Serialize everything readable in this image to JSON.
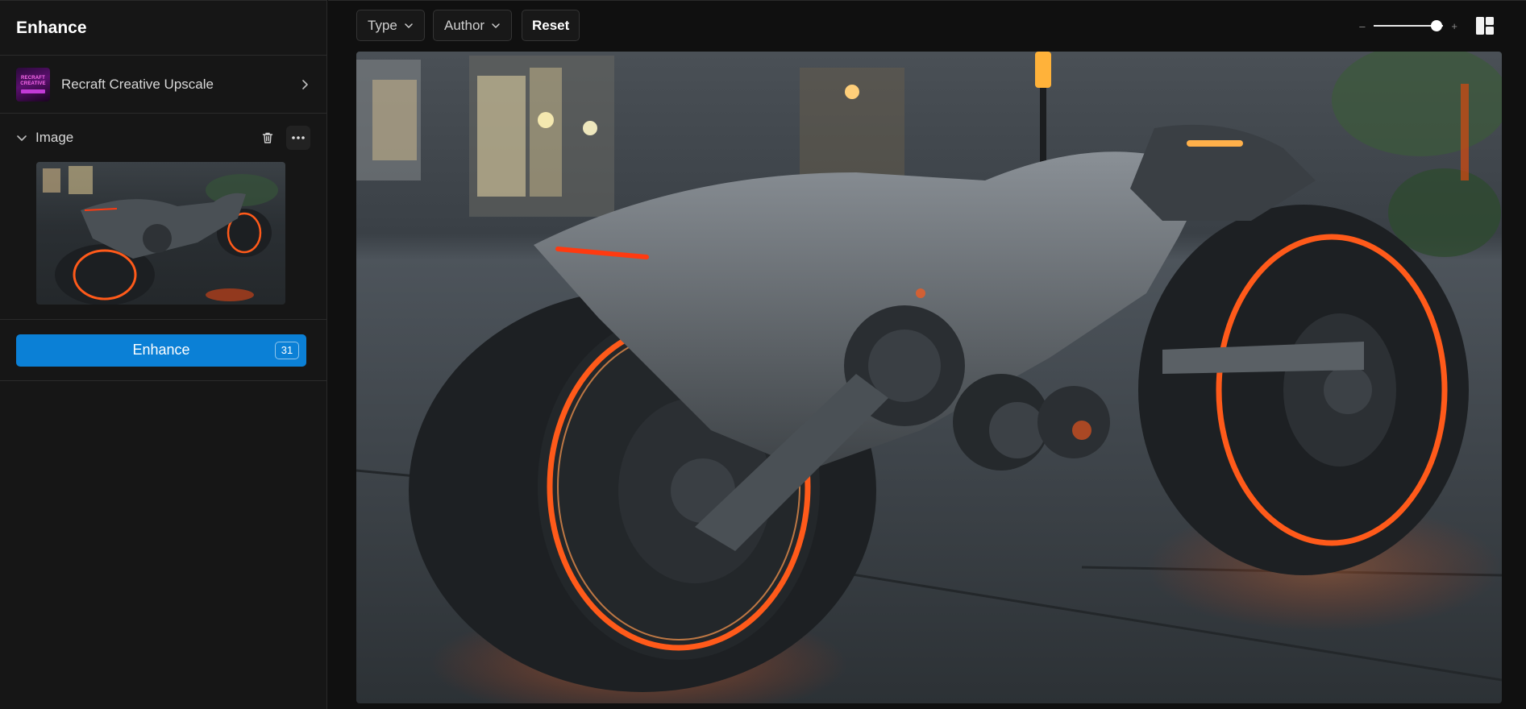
{
  "sidebar": {
    "title": "Enhance",
    "model": {
      "label": "Recraft Creative Upscale",
      "thumb_lines": [
        "RECRAFT",
        "CREATIVE"
      ]
    },
    "image_section": {
      "label": "Image"
    },
    "enhance_button": {
      "label": "Enhance",
      "credits": "31"
    }
  },
  "toolbar": {
    "type_filter": "Type",
    "author_filter": "Author",
    "reset_label": "Reset",
    "zoom": {
      "minus": "–",
      "plus": "+",
      "level_fraction": 0.9
    }
  },
  "colors": {
    "accent": "#0b80d6",
    "background": "#101010",
    "sidebar": "#161616",
    "glow": "#ff5a1a"
  },
  "icons": [
    "chevron-right-icon",
    "chevron-down-icon",
    "trash-icon",
    "more-icon",
    "layout-grid-icon"
  ]
}
